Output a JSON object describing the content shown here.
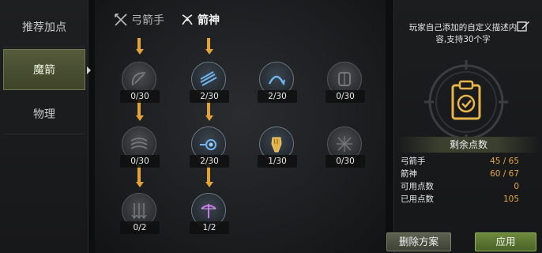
{
  "sidebar": {
    "items": [
      {
        "label": "推荐加点",
        "active": false
      },
      {
        "label": "魔箭",
        "active": true
      },
      {
        "label": "物理",
        "active": false
      }
    ]
  },
  "tabs": [
    {
      "label": "弓箭手",
      "icon": "crossed-arrows-icon",
      "active": false
    },
    {
      "label": "箭神",
      "icon": "crossed-bows-icon",
      "active": true
    }
  ],
  "skills": [
    {
      "icon": "bow-icon",
      "level": "0/30"
    },
    {
      "icon": "triple-arrow-icon",
      "level": "2/30"
    },
    {
      "icon": "arc-shot-icon",
      "level": "2/30"
    },
    {
      "icon": "armor-icon",
      "level": "0/30"
    },
    {
      "icon": "wind-streak-icon",
      "level": "0/30"
    },
    {
      "icon": "vortex-arrow-icon",
      "level": "2/30"
    },
    {
      "icon": "fist-icon",
      "level": "1/30"
    },
    {
      "icon": "shatter-icon",
      "level": "0/30"
    },
    {
      "icon": "arrow-rain-icon",
      "level": "0/2"
    },
    {
      "icon": "crossbow-icon",
      "level": "1/2"
    }
  ],
  "right_panel": {
    "note": "玩家自己添加的自定义描述内容,支持30个字",
    "points_header": "剩余点数",
    "stats": [
      {
        "label": "弓箭手",
        "value": "45 / 65"
      },
      {
        "label": "箭神",
        "value": "60 / 67"
      },
      {
        "label": "可用点数",
        "value": "0"
      },
      {
        "label": "已用点数",
        "value": "105"
      }
    ],
    "delete_label": "删除方案",
    "apply_label": "应用"
  },
  "colors": {
    "accent": "#e0a43a",
    "value": "#e8a640",
    "apply": "#5c7a32"
  }
}
